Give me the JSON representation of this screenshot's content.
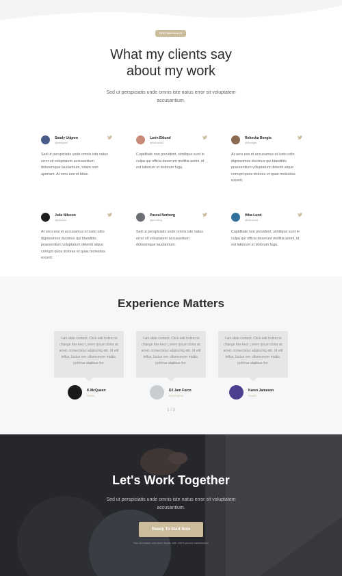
{
  "testimonials_section": {
    "badge": "TESTIMONIALS",
    "title_line1": "What my clients say",
    "title_line2": "about my work",
    "subtitle": "Sed ut perspiciatis unde omnis iste natus error sit voluptatem accusantium.",
    "accent_color": "#cbbd9c",
    "cards": [
      {
        "name": "Sandy Udgren",
        "handle": "@sdaigren",
        "text": "Sed ut perspiciatis unde omnis iste natus error sit voluptatem accusantium doloremque laudantium, totam rem aperiam. At vero eos et bitse.",
        "icon": "twitter-icon"
      },
      {
        "name": "Lorin Eklund",
        "handle": "@lorinekd2",
        "text": "Cupiditate non provident, similique sunt in culpa qui officia deserunt mollitia animi, id est laborum et dolorum fuga.",
        "icon": "twitter-icon"
      },
      {
        "name": "Rebecka Bengts",
        "handle": "@rbengts",
        "text": "At vero eos et accusamus et iusto odio dignissimos ducimus qui blanditiis praesentium voluptatum deleniti atque corrupti quos dolores et quas molestias excerit.",
        "icon": "twitter-icon"
      },
      {
        "name": "Julie Nilsson",
        "handle": "@julinssn",
        "text": "At vero eos et accusamus et iusto odio dignissimos ducimus qui blanditiis praesentium voluptatum deleniti atque corrupti quos dolores et quas molestias excerit.",
        "icon": "twitter-icon"
      },
      {
        "name": "Pascal Norborg",
        "handle": "@pnnrbrg",
        "text": "Sed ut perspiciatis unde omnis iste natus error sit voluptatem accusantium doloremque laudantium.",
        "icon": "twitter-icon"
      },
      {
        "name": "Hiba Lund",
        "handle": "@hibalund",
        "text": "Cupiditate non provident, similique sunt in culpa qui officia deserunt mollitia animi, id est laborum et dolorum fuga.",
        "icon": "twitter-icon"
      }
    ]
  },
  "experience_section": {
    "title": "Experience Matters",
    "slides": [
      {
        "quote": "I am slide content. Click edit button to change this text. Lorem ipsum dolor sit amet, consectetur adipiscing elit. Ut elit tellus, luctus nec ullamcorper mattis, pulvinar dapibus leo.",
        "name": "K.McQueen",
        "role": "Writer"
      },
      {
        "quote": "I am slide content. Click edit button to change this text. Lorem ipsum dolor sit amet, consectetur adipiscing elit. Ut elit tellus, luctus nec ullamcorper mattis, pulvinar dapibus leo.",
        "name": "DJ Jam Force",
        "role": "Entertainer"
      },
      {
        "quote": "I am slide content. Click edit button to change this text. Lorem ipsum dolor sit amet, consectetur adipiscing elit. Ut elit tellus, luctus nec ullamcorper mattis, pulvinar dapibus leo.",
        "name": "Karen Jameson",
        "role": "Model"
      }
    ],
    "pager": "1 / 3"
  },
  "cta_section": {
    "title": "Let's Work Together",
    "subtitle": "Sed ut perspiciatis unde omnis iste natus error sit voluptatem accusantium.",
    "button_label": "Ready To Start Now",
    "note": "Your purchase and dear results with 100% proven satisfaction!"
  }
}
